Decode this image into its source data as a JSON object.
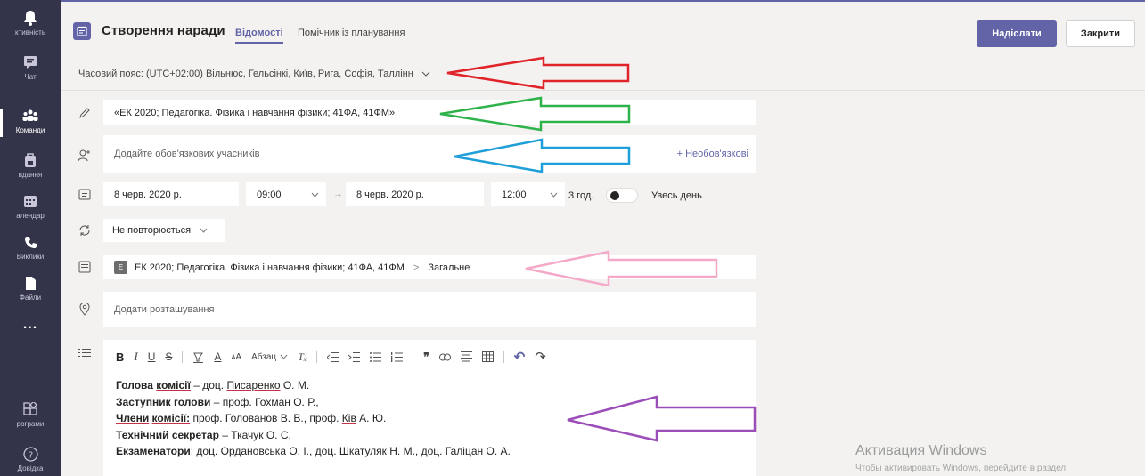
{
  "rail": {
    "items": [
      {
        "label": "ктивність"
      },
      {
        "label": "Чат"
      },
      {
        "label": "Команди"
      },
      {
        "label": "вдання"
      },
      {
        "label": "алендар"
      },
      {
        "label": "Виклики"
      },
      {
        "label": "Файли"
      },
      {
        "label": "..."
      },
      {
        "label": "рограми"
      },
      {
        "label": "Довідка"
      }
    ]
  },
  "header": {
    "title": "Створення наради",
    "tabs": [
      {
        "label": "Відомості"
      },
      {
        "label": "Помічник із планування"
      }
    ],
    "send_label": "Надіслати",
    "close_label": "Закрити"
  },
  "timezone": {
    "label": "Часовий пояс: (UTC+02:00) Вільнюс, Гельсінкі, Київ, Рига, Софія, Таллінн"
  },
  "form": {
    "title_value": "«ЕК 2020; Педагогіка. Фізика і навчання фізики; 41ФА, 41ФМ»",
    "attendees_placeholder": "Додайте обов'язкових учасників",
    "optional_link": "+ Необов'язкові",
    "start_date": "8 черв. 2020 р.",
    "start_time": "09:00",
    "end_date": "8 черв. 2020 р.",
    "end_time": "12:00",
    "duration": "3 год.",
    "all_day_label": "Увесь день",
    "repeat_value": "Не повторюється",
    "channel_tag": "Е",
    "channel_team": "ЕК 2020; Педагогіка. Фізика і навчання фізики; 41ФА, 41ФМ",
    "channel_name": "Загальне",
    "location_placeholder": "Додати розташування"
  },
  "editor": {
    "toolbar": {
      "bold": "B",
      "italic": "I",
      "underline": "U",
      "strike": "S",
      "font_color": "A",
      "font_size": "ᴀA",
      "paragraph": "Абзац",
      "clear_format": "Tₓ",
      "quote": "❞",
      "undo": "↶",
      "redo": "↷"
    },
    "lines": [
      {
        "b1": "Голова",
        "b2": "комісії",
        "rest": " – доц. ",
        "u": "Писаренко",
        "tail": " О. М."
      },
      {
        "b1": "Заступник",
        "b2": "голови",
        "rest": " – проф. ",
        "u": "Гохман",
        "tail": " О. Р.,"
      },
      {
        "b1": "Члени",
        "b2": "комісії:",
        "rest": " проф. Голованов В. В., проф. ",
        "u": "Ків",
        "tail": " А. Ю."
      },
      {
        "b1": "Технічний",
        "b2": "секретар",
        "rest": " – Ткачук О. С.",
        "u": "",
        "tail": ""
      },
      {
        "b1": "Екзаменатори",
        "b2": "",
        "rest": ": доц. ",
        "u": "Ордановська",
        "tail": " О. І., доц. Шкатуляк Н. М., доц. Галіцан О. А."
      }
    ]
  },
  "watermark": {
    "title": "Активация Windows",
    "subtitle": "Чтобы активировать Windows, перейдите в раздел"
  },
  "colors": {
    "accent": "#6264a7",
    "rail": "#33344a",
    "arrow_red": "#e0242a",
    "arrow_green": "#2db34a",
    "arrow_blue": "#1e9fd8",
    "arrow_pink": "#f5a9c8",
    "arrow_purple": "#9b4dba"
  }
}
